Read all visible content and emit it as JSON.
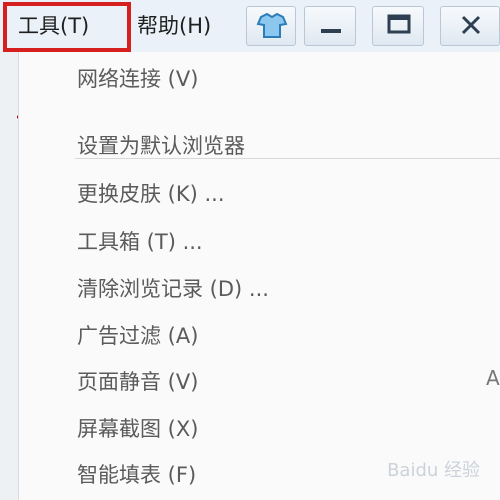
{
  "menubar": {
    "tools_label": "工具(T)",
    "help_label": "帮助(H)"
  },
  "menu": {
    "items": [
      {
        "label": "网络连接 (V)"
      },
      {
        "label": "设置为默认浏览器"
      },
      {
        "label": "更换皮肤 (K) ..."
      },
      {
        "label": "工具箱 (T) ..."
      },
      {
        "label": "清除浏览记录 (D) ..."
      },
      {
        "label": "广告过滤 (A)"
      },
      {
        "label": "页面静音 (V)"
      },
      {
        "label": "屏幕截图 (X)"
      },
      {
        "label": "智能填表 (F)"
      }
    ]
  },
  "edge_text": "A",
  "watermark": "Baidu 经验",
  "colors": {
    "annotation": "#d62020",
    "menubar_bg": "#eaf1f8",
    "menu_text": "#5b5b5b"
  },
  "icons": [
    "skin-icon",
    "minimize-icon",
    "maximize-icon",
    "close-icon",
    "up-arrow-annotation"
  ]
}
